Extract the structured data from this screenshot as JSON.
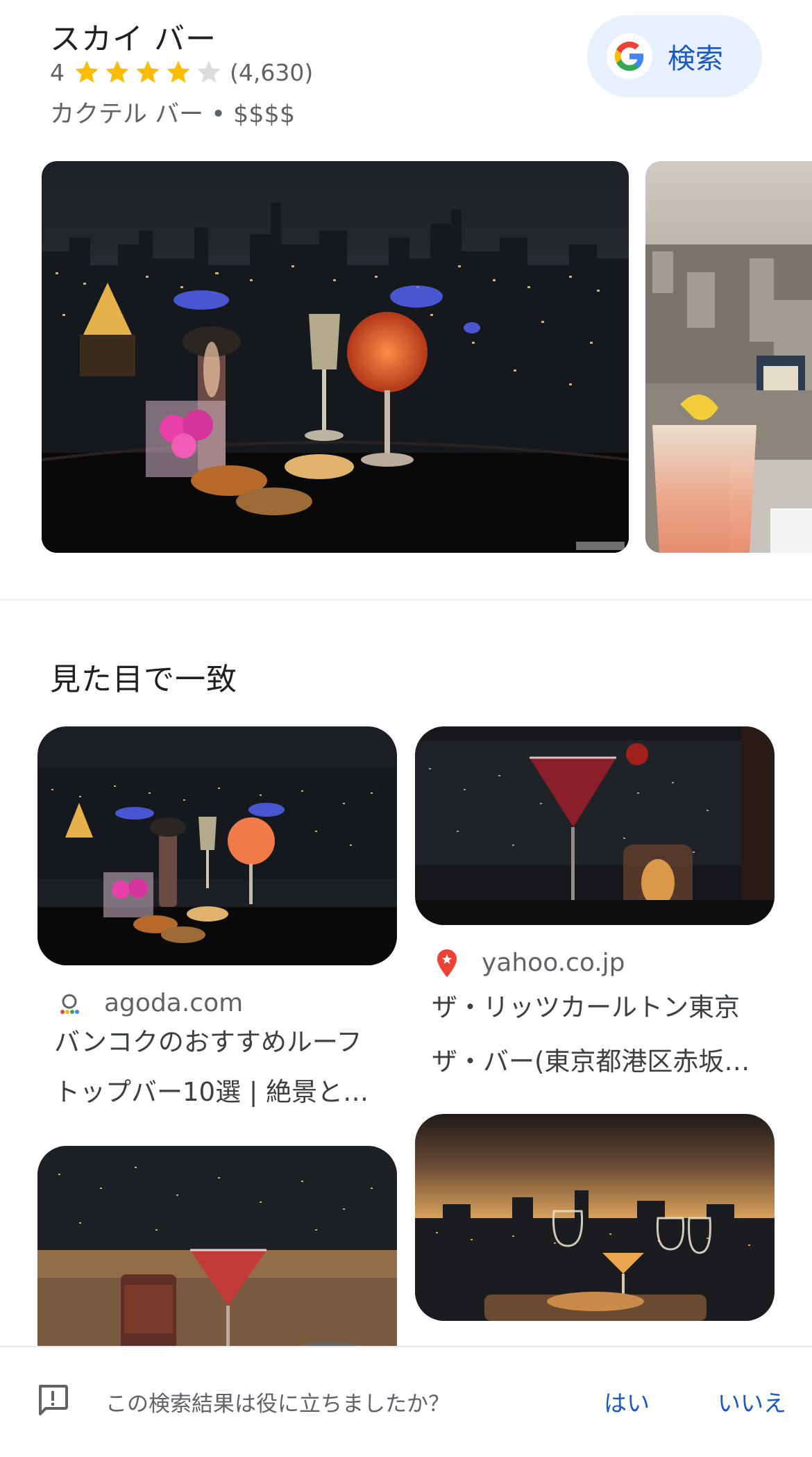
{
  "place": {
    "name": "スカイ バー",
    "rating": "4",
    "rating_value": 4,
    "rating_max": 5,
    "review_count": "(4,630)",
    "category_price": "カクテル バー • $$$$",
    "star_color": "#fbbc04",
    "star_empty_color": "#dadce0"
  },
  "search_button": {
    "label": "検索",
    "icon": "google-g-icon"
  },
  "hero_images": [
    {
      "alt": "rooftop bar night city cocktails"
    },
    {
      "alt": "cocktail over city view"
    }
  ],
  "visual_matches": {
    "title": "見た目で一致",
    "items": [
      {
        "source": "agoda.com",
        "source_icon": "agoda-icon",
        "line1": "バンコクのおすすめルーフ",
        "line2": "トップバー10選 | 絶景と…"
      },
      {
        "source": "yahoo.co.jp",
        "source_icon": "location-pin-icon",
        "line1": "ザ・リッツカールトン東京",
        "line2": "ザ・バー(東京都港区赤坂…"
      }
    ]
  },
  "feedback": {
    "question": "この検索結果は役に立ちましたか？",
    "yes": "はい",
    "no": "いいえ",
    "icon": "feedback-icon"
  },
  "colors": {
    "accent": "#1a57c7",
    "button_bg": "#e8f0fe"
  }
}
